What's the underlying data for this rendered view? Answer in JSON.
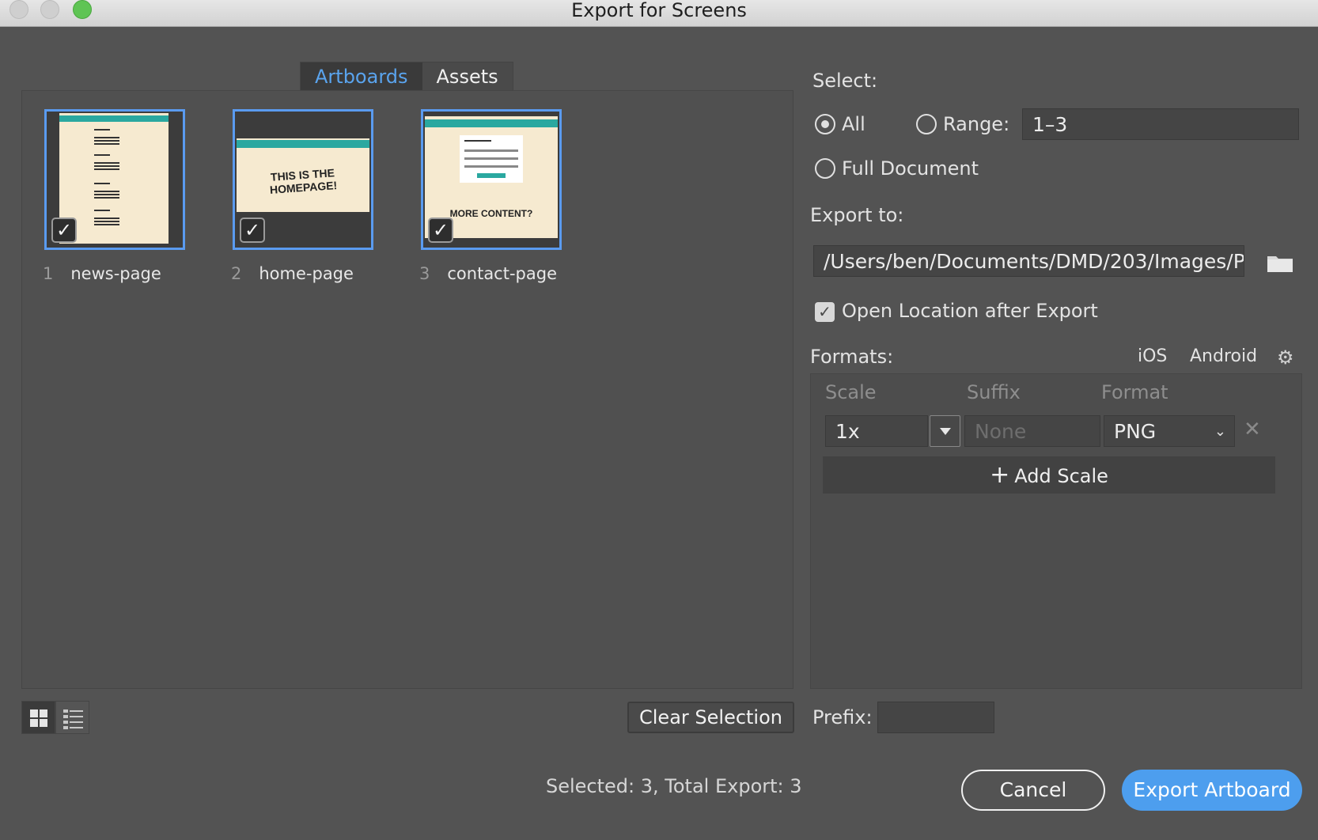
{
  "window": {
    "title": "Export for Screens"
  },
  "tabs": [
    {
      "label": "Artboards"
    },
    {
      "label": "Assets"
    }
  ],
  "artboards": [
    {
      "number": "1",
      "name": "news-page",
      "hero_text": "",
      "checked": true
    },
    {
      "number": "2",
      "name": "home-page",
      "hero_text": "THIS IS THE HOMEPAGE!",
      "checked": true
    },
    {
      "number": "3",
      "name": "contact-page",
      "hero_text": "MORE CONTENT?",
      "checked": true
    }
  ],
  "actions": {
    "clear_selection": "Clear Selection",
    "cancel": "Cancel",
    "export": "Export Artboard"
  },
  "status": {
    "text": "Selected: 3, Total Export: 3"
  },
  "select": {
    "label": "Select:",
    "all": "All",
    "range": "Range:",
    "range_value": "1–3",
    "full_document": "Full Document",
    "selected": "All"
  },
  "export_to": {
    "label": "Export to:",
    "path": "/Users/ben/Documents/DMD/203/Images/P",
    "open_location": "Open Location after Export",
    "open_location_checked": true
  },
  "formats": {
    "label": "Formats:",
    "ios": "iOS",
    "android": "Android",
    "columns": {
      "scale": "Scale",
      "suffix": "Suffix",
      "format": "Format"
    },
    "rows": [
      {
        "scale": "1x",
        "suffix_placeholder": "None",
        "format": "PNG"
      }
    ],
    "add_scale": "Add Scale"
  },
  "prefix": {
    "label": "Prefix:",
    "value": ""
  },
  "colors": {
    "accent": "#4d9eee",
    "background": "#535353",
    "thumb_bar": "#2aa8a0",
    "page_bg": "#f6ead0"
  }
}
